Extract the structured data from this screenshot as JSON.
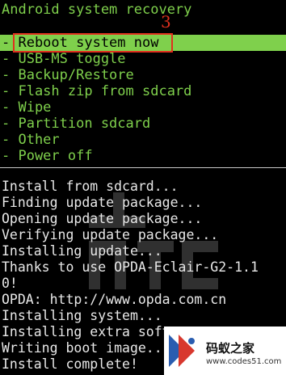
{
  "header": {
    "title": "Android system recovery"
  },
  "menu": {
    "items": [
      {
        "label": "- Reboot system now"
      },
      {
        "label": "- USB-MS toggle"
      },
      {
        "label": "- Backup/Restore"
      },
      {
        "label": "- Flash zip from sdcard"
      },
      {
        "label": "- Wipe"
      },
      {
        "label": "- Partition sdcard"
      },
      {
        "label": "- Other"
      },
      {
        "label": "- Power off"
      }
    ],
    "selected_index": 0
  },
  "annotation": {
    "number": "3",
    "color": "#e0301e"
  },
  "log": {
    "lines": [
      "Install from sdcard...",
      "Finding update package...",
      "Opening update package...",
      "Verifying update package...",
      "Installing update...",
      "Thanks to use OPDA-Eclair-G2-1.1",
      "0!",
      "OPDA: http://www.opda.com.cn",
      "Installing system...",
      "Installing extra softwares...",
      "Writing boot image...",
      "Install complete!"
    ]
  },
  "colors": {
    "background": "#000000",
    "menu_text": "#7fd04c",
    "selected_bg": "#7fd04c",
    "log_text": "#e8e8e8"
  },
  "watermark": {
    "brand": "码蚁之家",
    "url": "www.codes51.com"
  }
}
